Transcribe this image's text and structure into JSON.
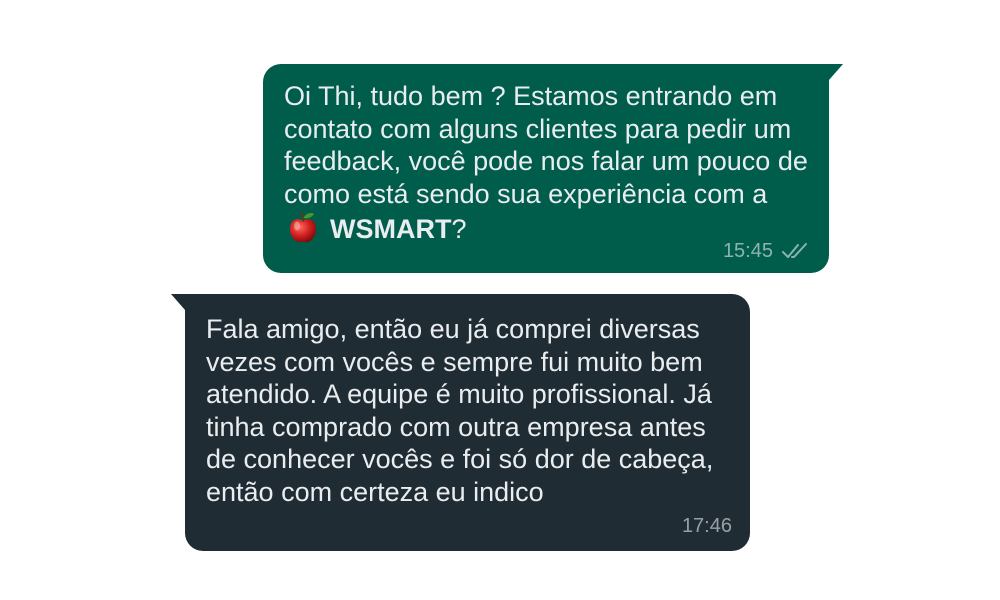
{
  "chat": {
    "messages": [
      {
        "direction": "outgoing",
        "text_before_brand": "Oi Thi, tudo bem ? Estamos entrando em contato com alguns clientes para pedir um feedback, você pode nos falar um pouco de como está sendo sua experiência com a",
        "brand_icon": "apple-icon",
        "brand": "WSMART",
        "text_after_brand": "?",
        "time": "15:45",
        "status_icon": "double-check-icon",
        "bubble_color": "#005c4b"
      },
      {
        "direction": "incoming",
        "text": "Fala amigo, então eu já comprei diversas vezes com vocês e sempre fui muito bem atendido. A equipe é muito profissional. Já tinha comprado com outra empresa antes de conhecer vocês e foi só dor de cabeça, então com certeza eu indico",
        "time": "17:46",
        "bubble_color": "#202c33"
      }
    ]
  }
}
